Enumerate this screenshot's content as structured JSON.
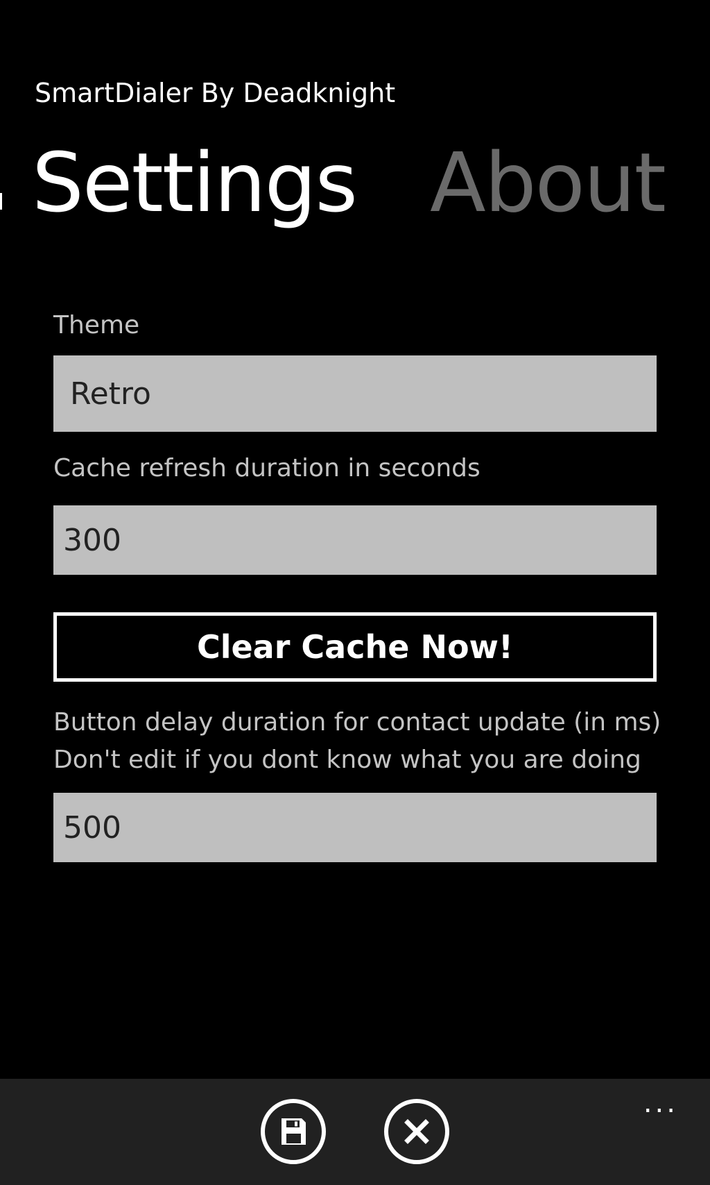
{
  "app": {
    "title": "SmartDialer By Deadknight"
  },
  "pivot": {
    "tabs": [
      {
        "label": "Settings",
        "active": true
      },
      {
        "label": "About",
        "active": false
      }
    ]
  },
  "settings": {
    "theme": {
      "label": "Theme",
      "value": "Retro"
    },
    "cache_refresh": {
      "label": "Cache refresh duration in seconds",
      "value": "300"
    },
    "clear_cache_button": "Clear Cache Now!",
    "button_delay": {
      "label_line1": "Button delay duration for contact update (in ms)",
      "label_line2": "Don't edit if you dont know what you are doing",
      "value": "500"
    }
  },
  "appbar": {
    "buttons": [
      {
        "icon": "save-icon"
      },
      {
        "icon": "close-icon"
      }
    ],
    "more": "..."
  },
  "colors": {
    "background": "#000000",
    "field_background": "#bfbfbf",
    "inactive_pivot": "#6a6a6a",
    "appbar": "#212121"
  }
}
